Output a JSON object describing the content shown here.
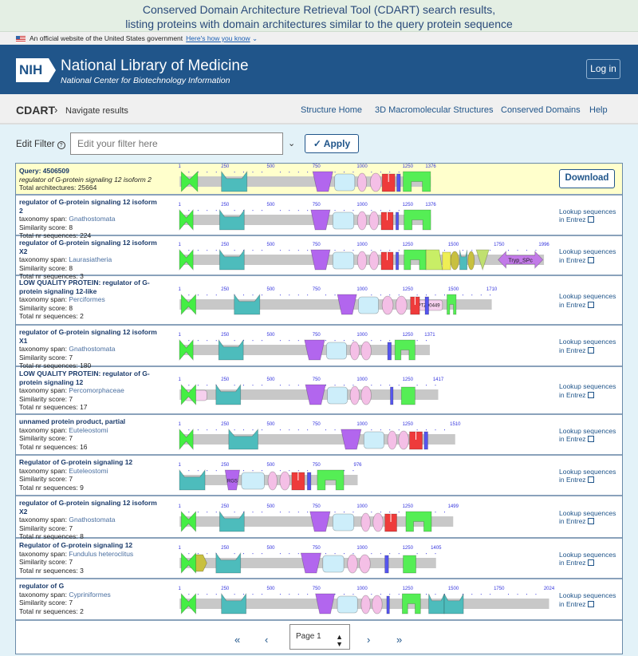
{
  "banner": {
    "line1": "Conserved Domain Architecture Retrieval Tool (CDART) search results,",
    "line2": "listing proteins with domain architectures similar to the query protein sequence"
  },
  "gov": {
    "text": "An official website of the United States government",
    "link": "Here's how you know"
  },
  "header": {
    "logo": "NIH",
    "title": "National Library of Medicine",
    "subtitle": "National Center for Biotechnology Information",
    "login": "Log in"
  },
  "subnav": {
    "app": "CDART",
    "crumb": "Navigate results",
    "links": [
      "Structure Home",
      "3D Macromolecular Structures",
      "Conserved Domains",
      "Help"
    ]
  },
  "filter": {
    "label": "Edit Filter",
    "placeholder": "Edit your filter here",
    "apply": "Apply"
  },
  "colors": {
    "bowtie": "#44ee44",
    "notch": "#4dbcbc",
    "trap": "#b266ee",
    "rrect": "#cdeefa",
    "ellipse": "#f4bfe6",
    "red": "#ee3b3b",
    "blue": "#5555ee",
    "arch": "#55ee55",
    "lime": "#c8ee66",
    "yellow": "#eeee55",
    "olive": "#c8c040",
    "tri": "#c0e070",
    "arrow": "#c27ae8",
    "pinkrect": "#f6d0ee",
    "hex": "#c8c040",
    "bar": "#c8c8c8",
    "tick": "#3333dd"
  },
  "labels": {
    "taxonomy": "taxonomy span: ",
    "score": "Similarity score: ",
    "total": "Total nr sequences: ",
    "lookup1": "Lookup sequences",
    "lookup2": "in Entrez",
    "download": "Download"
  },
  "query": {
    "title": "Query: 4506509",
    "subtitle": "regulator of G-protein signaling 12 isoform 2",
    "total": "Total architectures: 25664",
    "length": 1376,
    "domains": [
      [
        "bowtie",
        10,
        100
      ],
      [
        "notch",
        230,
        370
      ],
      [
        "trap",
        730,
        840
      ],
      [
        "rrect",
        850,
        960
      ],
      [
        "ellipse",
        975,
        1025
      ],
      [
        "ellipse",
        1045,
        1105
      ],
      [
        "red",
        1110,
        1180
      ],
      [
        "blue",
        1190,
        1210
      ],
      [
        "arch",
        1225,
        1375
      ]
    ]
  },
  "rows": [
    {
      "title": "regulator of G-protein signaling 12 isoform 2",
      "taxonomy": "Gnathostomata",
      "score": "8",
      "total": "224",
      "length": 1376,
      "domains": [
        [
          "bowtie",
          0,
          75
        ],
        [
          "notch",
          220,
          355
        ],
        [
          "trap",
          720,
          825
        ],
        [
          "rrect",
          840,
          955
        ],
        [
          "ellipse",
          975,
          1025
        ],
        [
          "ellipse",
          1040,
          1090
        ],
        [
          "red",
          1105,
          1170
        ],
        [
          "blue",
          1185,
          1200
        ],
        [
          "arch",
          1230,
          1376
        ]
      ]
    },
    {
      "title": "regulator of G-protein signaling 12 isoform X2",
      "taxonomy": "Laurasiatheria",
      "score": "8",
      "total": "3",
      "length": 1996,
      "domains": [
        [
          "bowtie",
          0,
          75
        ],
        [
          "notch",
          220,
          355
        ],
        [
          "trap",
          720,
          825
        ],
        [
          "rrect",
          840,
          955
        ],
        [
          "ellipse",
          975,
          1025
        ],
        [
          "ellipse",
          1040,
          1090
        ],
        [
          "red",
          1105,
          1170
        ],
        [
          "blue",
          1185,
          1200
        ],
        [
          "arch",
          1230,
          1350
        ],
        [
          "lime",
          1350,
          1440
        ],
        [
          "yellow",
          1440,
          1485
        ],
        [
          "olive",
          1485,
          1530
        ],
        [
          "notch",
          1535,
          1575
        ],
        [
          "olive",
          1580,
          1615
        ],
        [
          "tri",
          1625,
          1695
        ],
        [
          "arrow",
          1745,
          1990,
          "Tryp_SPc"
        ]
      ]
    },
    {
      "title": "LOW QUALITY PROTEIN: regulator of G-protein signaling 12-like",
      "taxonomy": "Perciformes",
      "score": "8",
      "total": "2",
      "length": 1710,
      "domains": [
        [
          "bowtie",
          10,
          90
        ],
        [
          "notch",
          300,
          440
        ],
        [
          "trap",
          865,
          970
        ],
        [
          "rrect",
          980,
          1090
        ],
        [
          "ellipse",
          1110,
          1170
        ],
        [
          "ellipse",
          1185,
          1245
        ],
        [
          "pinkrect",
          1290,
          1440,
          "PTZ00449"
        ],
        [
          "red",
          1265,
          1315
        ],
        [
          "blue",
          1345,
          1365
        ],
        [
          "arch",
          1465,
          1515
        ]
      ]
    },
    {
      "title": "regulator of G-protein signaling 12 isoform X1",
      "taxonomy": "Gnathostomata",
      "score": "7",
      "total": "180",
      "length": 1371,
      "domains": [
        [
          "bowtie",
          0,
          75
        ],
        [
          "notch",
          215,
          350
        ],
        [
          "trap",
          685,
          795
        ],
        [
          "rrect",
          805,
          915
        ],
        [
          "ellipse",
          935,
          985
        ],
        [
          "ellipse",
          995,
          1050
        ],
        [
          "blue",
          1140,
          1160
        ],
        [
          "arch",
          1180,
          1290
        ]
      ]
    },
    {
      "title": "LOW QUALITY PROTEIN: regulator of G-protein signaling 12",
      "taxonomy": "Percomorphaceae",
      "score": "7",
      "total": "17",
      "length": 1417,
      "domains": [
        [
          "pinkrect",
          30,
          150
        ],
        [
          "bowtie",
          10,
          90
        ],
        [
          "notch",
          200,
          335
        ],
        [
          "trap",
          690,
          800
        ],
        [
          "rrect",
          810,
          920
        ],
        [
          "ellipse",
          935,
          985
        ],
        [
          "ellipse",
          995,
          1050
        ],
        [
          "blue",
          1155,
          1170
        ],
        [
          "red2",
          1215,
          1290
        ]
      ]
    },
    {
      "title": "unnamed protein product, partial",
      "taxonomy": "Euteleostomi",
      "score": "7",
      "total": "16",
      "length": 1510,
      "domains": [
        [
          "bowtie",
          0,
          75
        ],
        [
          "notch",
          270,
          430
        ],
        [
          "trap",
          885,
          995
        ],
        [
          "rrect",
          1010,
          1120
        ],
        [
          "ellipse",
          1140,
          1190
        ],
        [
          "ellipse",
          1200,
          1255
        ],
        [
          "red",
          1260,
          1330
        ],
        [
          "blue",
          1340,
          1360
        ]
      ]
    },
    {
      "title": "Regulator of G-protein signaling 12",
      "taxonomy": "Euteleostomi",
      "score": "7",
      "total": "9",
      "length": 976,
      "domains": [
        [
          "notch",
          0,
          140
        ],
        [
          "trap",
          250,
          330,
          "RGS"
        ],
        [
          "rrect",
          340,
          465
        ],
        [
          "ellipse",
          485,
          535
        ],
        [
          "ellipse",
          550,
          605
        ],
        [
          "red",
          615,
          685
        ],
        [
          "blue",
          700,
          720
        ],
        [
          "arch",
          755,
          900
        ]
      ]
    },
    {
      "title": "regulator of G-protein signaling 12 isoform X2",
      "taxonomy": "Gnathostomata",
      "score": "7",
      "total": "8",
      "length": 1499,
      "domains": [
        [
          "bowtie",
          10,
          90
        ],
        [
          "notch",
          220,
          355
        ],
        [
          "trap",
          715,
          825
        ],
        [
          "rrect",
          840,
          955
        ],
        [
          "ellipse",
          995,
          1045
        ],
        [
          "ellipse",
          1060,
          1115
        ],
        [
          "red",
          1125,
          1190
        ],
        [
          "arch",
          1240,
          1380
        ]
      ]
    },
    {
      "title": "Regulator of G-protein signaling 12",
      "taxonomy": "Fundulus heteroclitus",
      "score": "7",
      "total": "3",
      "length": 1405,
      "domains": [
        [
          "hex",
          65,
          150
        ],
        [
          "bowtie",
          10,
          90
        ],
        [
          "notch",
          200,
          335
        ],
        [
          "trap",
          665,
          775
        ],
        [
          "rrect",
          785,
          900
        ],
        [
          "ellipse",
          920,
          975
        ],
        [
          "ellipse",
          985,
          1045
        ],
        [
          "blue",
          1125,
          1145
        ],
        [
          "red2",
          1225,
          1295
        ]
      ]
    },
    {
      "title": "regulator of G",
      "taxonomy": "Cypriniformes",
      "score": "7",
      "total": "2",
      "length": 2024,
      "domains": [
        [
          "bowtie",
          10,
          90
        ],
        [
          "notch",
          230,
          365
        ],
        [
          "trap",
          745,
          850
        ],
        [
          "rrect",
          865,
          975
        ],
        [
          "ellipse",
          995,
          1045
        ],
        [
          "ellipse",
          1055,
          1110
        ],
        [
          "blue",
          1135,
          1150
        ],
        [
          "arch",
          1220,
          1320
        ],
        [
          "notch",
          1365,
          1450
        ],
        [
          "notch",
          1450,
          1555
        ]
      ]
    }
  ],
  "pager": {
    "first": "«",
    "prev": "‹",
    "page": "Page 1",
    "next": "›",
    "last": "»"
  }
}
